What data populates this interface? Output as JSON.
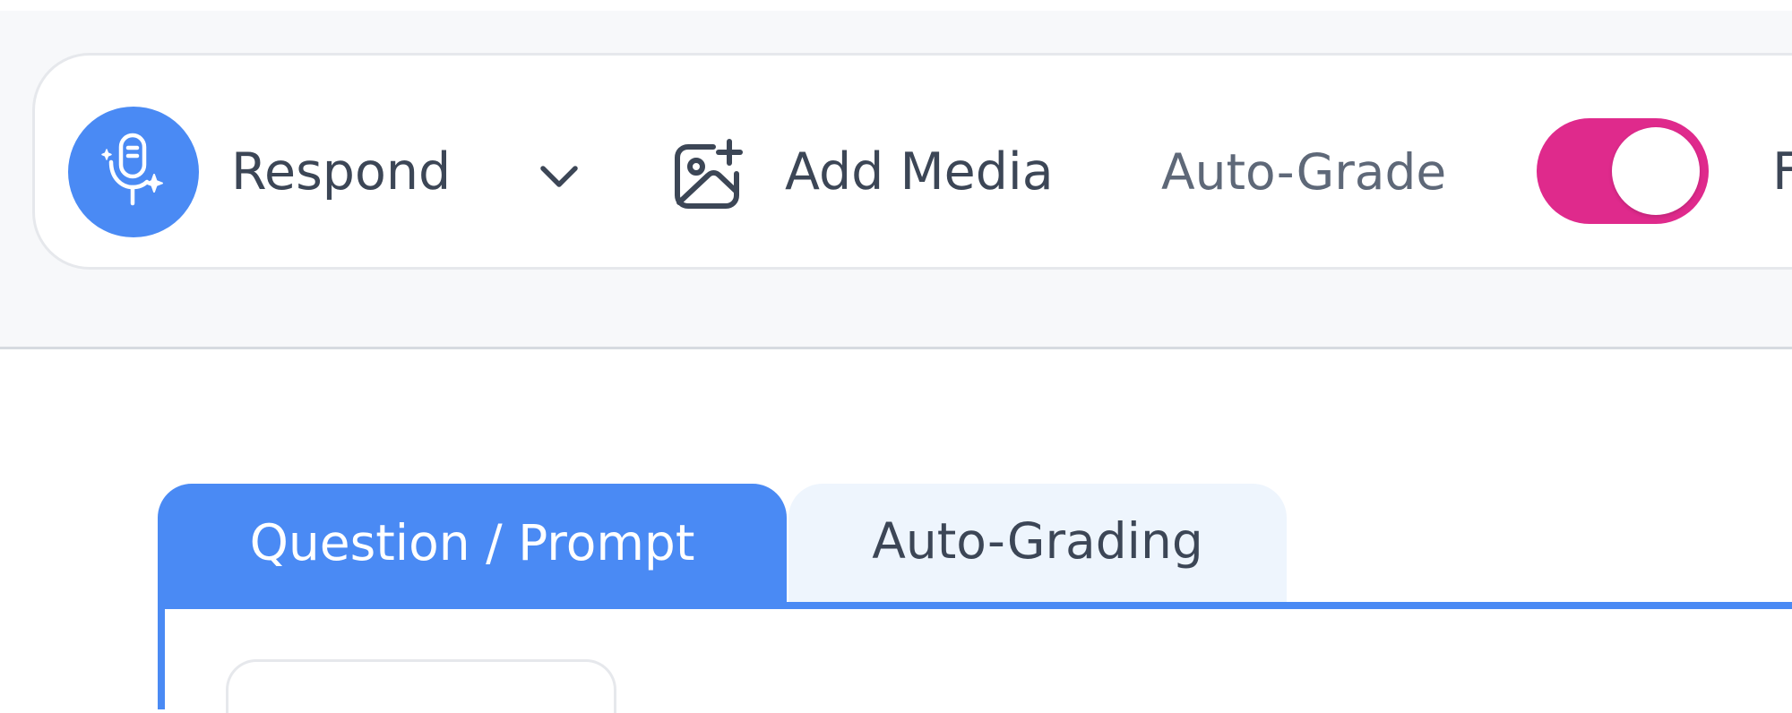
{
  "toolbar": {
    "respond_label": "Respond",
    "add_media_label": "Add Media",
    "auto_grade_label": "Auto-Grade",
    "auto_grade_enabled": true,
    "next_item_partial": "F"
  },
  "tabs": [
    {
      "label": "Question / Prompt",
      "active": true
    },
    {
      "label": "Auto-Grading",
      "active": false
    }
  ],
  "colors": {
    "primary_blue": "#4a8af4",
    "toggle_pink": "#df2a8c",
    "text_dark": "#3c4656",
    "text_muted": "#5e6878",
    "tab_inactive_bg": "#eef5fd"
  },
  "icons": {
    "respond": "ai-microphone-icon",
    "dropdown": "chevron-down-icon",
    "media": "add-image-icon"
  }
}
